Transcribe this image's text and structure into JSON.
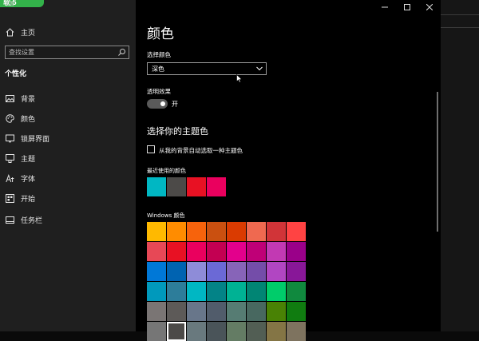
{
  "app": {
    "title": "设置",
    "logo_text": "软 5"
  },
  "nav": {
    "home_label": "主页",
    "search_placeholder": "查找设置",
    "section_title": "个性化",
    "items": [
      {
        "label": "背景",
        "icon": "picture-icon"
      },
      {
        "label": "颜色",
        "icon": "palette-icon"
      },
      {
        "label": "锁屏界面",
        "icon": "lock-screen-icon"
      },
      {
        "label": "主题",
        "icon": "theme-brush-icon"
      },
      {
        "label": "字体",
        "icon": "font-icon"
      },
      {
        "label": "开始",
        "icon": "start-menu-icon"
      },
      {
        "label": "任务栏",
        "icon": "taskbar-icon"
      }
    ]
  },
  "main": {
    "title": "颜色",
    "choose_color_label": "选择颜色",
    "choose_color_value": "深色",
    "transparency_label": "透明效果",
    "transparency_state": "开",
    "accent_title": "选择你的主题色",
    "auto_accent_label": "从我的背景自动选取一种主题色",
    "recent_label": "最近使用的颜色",
    "recent_colors": [
      "#00b7c3",
      "#4c4a48",
      "#e81123",
      "#ea005e"
    ],
    "windows_colors_label": "Windows 颜色",
    "windows_colors": [
      "#ffb900",
      "#ff8c00",
      "#f7630c",
      "#ca5010",
      "#da3b01",
      "#ef6950",
      "#d13438",
      "#ff4343",
      "#e74856",
      "#e81123",
      "#ea005e",
      "#c30052",
      "#e3008c",
      "#bf0077",
      "#c239b3",
      "#9a0089",
      "#0078d7",
      "#0063b1",
      "#8e8cd8",
      "#6b69d6",
      "#8764b8",
      "#744da9",
      "#b146c2",
      "#881798",
      "#0099bc",
      "#2d7d9a",
      "#00b7c3",
      "#038387",
      "#00b294",
      "#018574",
      "#00cc6a",
      "#10893e",
      "#7a7574",
      "#5d5a58",
      "#68768a",
      "#515c6b",
      "#567c73",
      "#486860",
      "#498205",
      "#107c10",
      "#767676",
      "#4c4a48",
      "#69797e",
      "#4a5459",
      "#647c64",
      "#525e54",
      "#847545",
      "#7e735f"
    ],
    "selected_color": "#4c4a48"
  }
}
